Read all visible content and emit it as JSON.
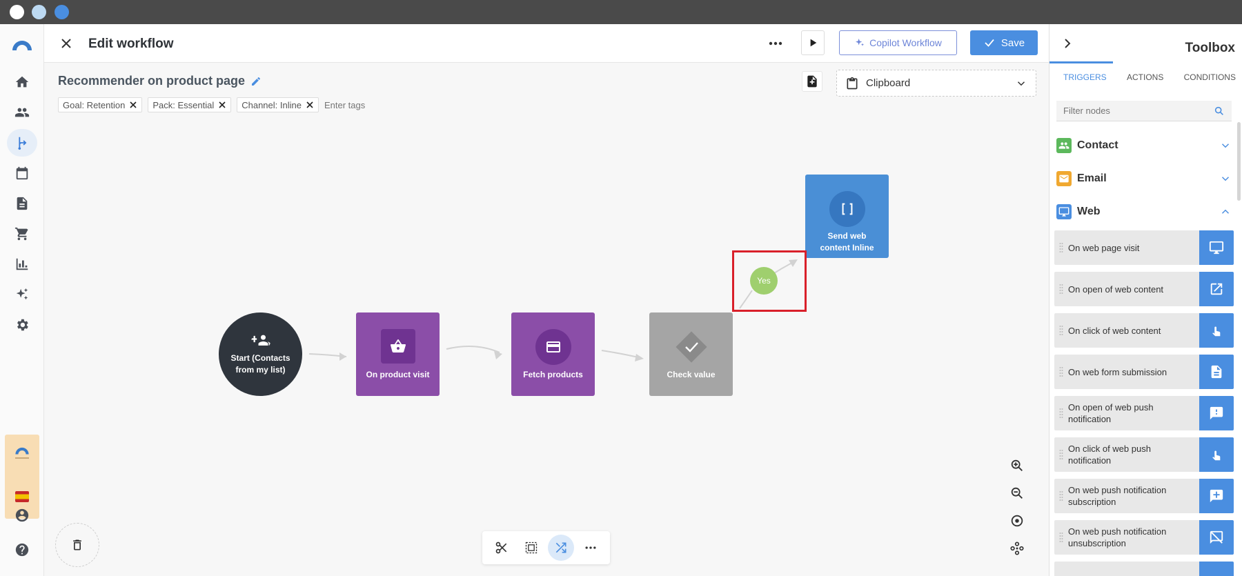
{
  "header": {
    "title": "Edit workflow",
    "copilot_label": "Copilot Workflow",
    "save_label": "Save"
  },
  "workflow": {
    "name": "Recommender on product page",
    "tags": [
      "Goal: Retention",
      "Pack: Essential",
      "Channel: Inline"
    ],
    "tag_placeholder": "Enter tags",
    "clipboard_label": "Clipboard"
  },
  "nodes": {
    "start": "Start (Contacts from my list)",
    "product_visit": "On product visit",
    "fetch_products": "Fetch products",
    "check_value": "Check value",
    "send_web": "Send web content Inline",
    "yes_label": "Yes"
  },
  "toolbox": {
    "title": "Toolbox",
    "tabs": [
      "TRIGGERS",
      "ACTIONS",
      "CONDITIONS"
    ],
    "filter_placeholder": "Filter nodes",
    "categories": [
      "Contact",
      "Email",
      "Web"
    ],
    "items": [
      "On web page visit",
      "On open of web content",
      "On click of web content",
      "On web form submission",
      "On open of web push notification",
      "On click of web push notification",
      "On web push notification subscription",
      "On web push notification unsubscription"
    ]
  },
  "colors": {
    "accent": "#4a8ee0",
    "purple_node": "#8b4ea8",
    "start_node": "#2f353d",
    "check_node": "#a5a5a5",
    "yes_pill": "#9fcf6e",
    "highlight": "#d9202a",
    "brand_box": "#f8ddb4"
  }
}
